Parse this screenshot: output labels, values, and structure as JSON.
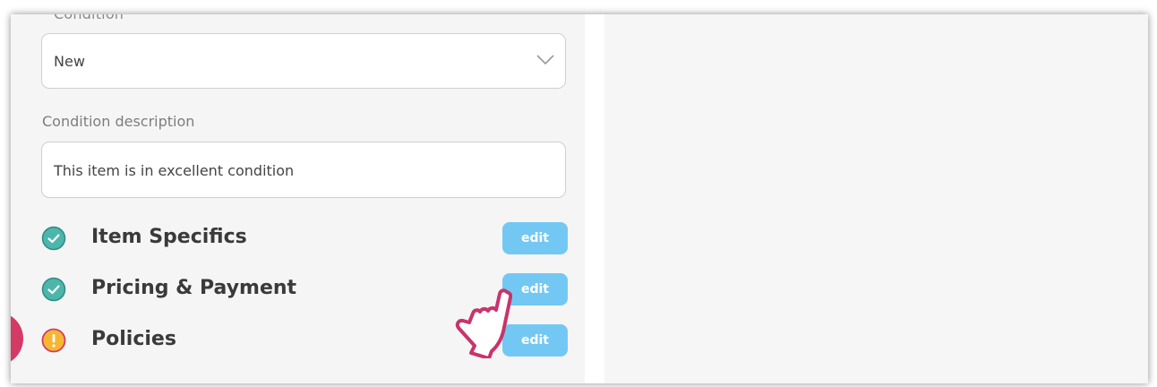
{
  "form": {
    "condition_label_cut": "Condition",
    "condition_value": "New",
    "description_label": "Condition description",
    "description_value": "This item is in excellent condition"
  },
  "sections": [
    {
      "title": "Item Specifics",
      "status": "complete",
      "status_icon": "check-circle-icon",
      "edit_label": "edit"
    },
    {
      "title": "Pricing & Payment",
      "status": "complete",
      "status_icon": "check-circle-icon",
      "edit_label": "edit"
    },
    {
      "title": "Policies",
      "status": "warning",
      "status_icon": "info-circle-icon",
      "edit_label": "edit"
    }
  ],
  "colors": {
    "complete": "#4db6ac",
    "warning": "#f5b731",
    "warning_ring": "#d33b66",
    "edit_button": "#73c8f3",
    "cursor_outline": "#c8346a",
    "fab": "#d33b66"
  }
}
